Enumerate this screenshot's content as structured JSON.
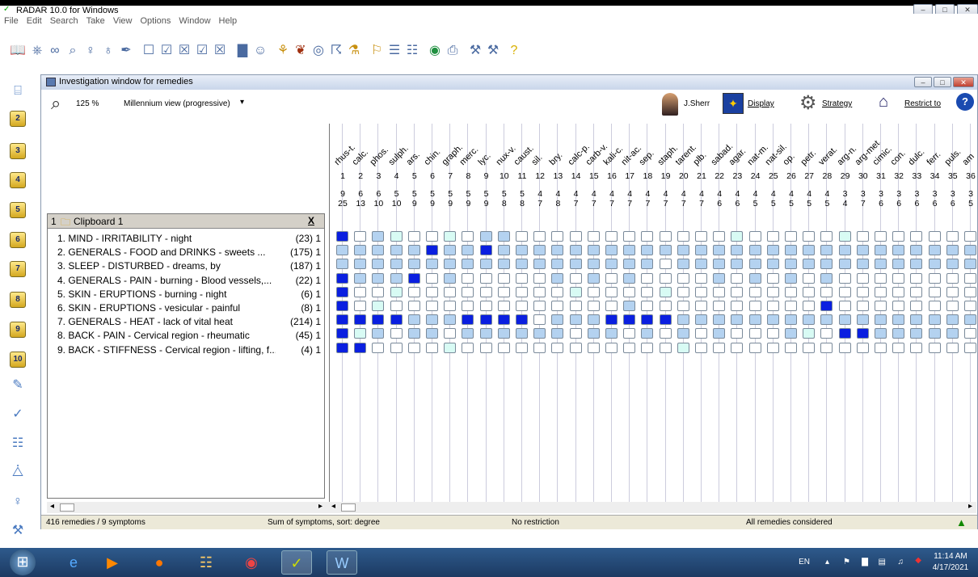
{
  "window": {
    "title": "RADAR 10.0 for Windows"
  },
  "menu": [
    "File",
    "Edit",
    "Search",
    "Take",
    "View",
    "Options",
    "Window",
    "Help"
  ],
  "rail_numbers": [
    "1",
    "2",
    "3",
    "4",
    "5",
    "6",
    "7",
    "8",
    "9",
    "10"
  ],
  "invwin": {
    "title": "Investigation window for remedies",
    "zoom": "125 %",
    "view": "Millennium view (progressive)",
    "author": "J.Sherr",
    "display": "Display",
    "strategy": "Strategy",
    "restrict": "Restrict to"
  },
  "clipboard": {
    "label": "1",
    "name": "Clipboard 1",
    "close": "X"
  },
  "symptoms": [
    {
      "text": "1. MIND - IRRITABILITY - night",
      "count": "(23) 1"
    },
    {
      "text": "2. GENERALS - FOOD and DRINKS - sweets ...",
      "count": "(175) 1"
    },
    {
      "text": "3. SLEEP - DISTURBED - dreams, by",
      "count": "(187) 1"
    },
    {
      "text": "4. GENERALS - PAIN - burning - Blood vessels,...",
      "count": "(22) 1"
    },
    {
      "text": "5. SKIN - ERUPTIONS - burning - night",
      "count": "(6) 1"
    },
    {
      "text": "6. SKIN - ERUPTIONS - vesicular - painful",
      "count": "(8) 1"
    },
    {
      "text": "7. GENERALS - HEAT - lack of vital heat",
      "count": "(214) 1"
    },
    {
      "text": "8. BACK - PAIN - Cervical region - rheumatic",
      "count": "(45) 1"
    },
    {
      "text": "9. BACK - STIFFNESS - Cervical region - lifting, f...",
      "count": "(4) 1"
    }
  ],
  "remedies": [
    "rhus-t.",
    "calc.",
    "phos.",
    "sulph.",
    "ars.",
    "chin.",
    "graph.",
    "merc.",
    "lyc.",
    "nux-v.",
    "caust.",
    "sil.",
    "bry.",
    "calc-p.",
    "carb-v.",
    "kali-c.",
    "nit-ac.",
    "sep.",
    "staph.",
    "tarent.",
    "plb.",
    "sabad.",
    "agar.",
    "nat-m.",
    "nat-sil.",
    "op.",
    "petr.",
    "verat.",
    "arg-n.",
    "arg-met.",
    "cimic.",
    "con.",
    "dulc.",
    "ferr.",
    "puls.",
    "am"
  ],
  "remedy_nums": [
    "1",
    "2",
    "3",
    "4",
    "5",
    "6",
    "7",
    "8",
    "9",
    "10",
    "11",
    "12",
    "13",
    "14",
    "15",
    "16",
    "17",
    "18",
    "19",
    "20",
    "21",
    "22",
    "23",
    "24",
    "25",
    "26",
    "27",
    "28",
    "29",
    "30",
    "31",
    "32",
    "33",
    "34",
    "35",
    "36"
  ],
  "scores": [
    "9",
    "6",
    "6",
    "5",
    "5",
    "5",
    "5",
    "5",
    "5",
    "5",
    "5",
    "4",
    "4",
    "4",
    "4",
    "4",
    "4",
    "4",
    "4",
    "4",
    "4",
    "4",
    "4",
    "4",
    "4",
    "4",
    "4",
    "4",
    "3",
    "3",
    "3",
    "3",
    "3",
    "3",
    "3",
    "3"
  ],
  "degrees": [
    "25",
    "13",
    "10",
    "10",
    "9",
    "9",
    "9",
    "9",
    "9",
    "8",
    "8",
    "7",
    "8",
    "7",
    "7",
    "7",
    "7",
    "7",
    "7",
    "7",
    "7",
    "6",
    "6",
    "5",
    "5",
    "5",
    "5",
    "5",
    "4",
    "7",
    "6",
    "6",
    "6",
    "6",
    "6",
    "5"
  ],
  "grid": [
    "3021001022000000000000100000100000000",
    "2222232232222222222222222222222222222",
    "2222222222222222220222222222222222222",
    "3222302000002020200002020202000000000",
    "3001000000000100001000000000000000000",
    "3010000000000000200000000003000000000",
    "3333222333302223333222222222222222222",
    "3120220222222022020202000210332222200",
    "3300001000000000000100000000000000000"
  ],
  "colors": {
    "d0": "#ffffff",
    "d1": "#d8fbf4",
    "d2": "#b4d2f0",
    "d3": "#0a1fe0"
  },
  "status": {
    "remedies": "416 remedies / 9 symptoms",
    "sort": "Sum of symptoms, sort: degree",
    "restrict": "No restriction",
    "considered": "All remedies considered"
  },
  "clock": {
    "time": "11:14 AM",
    "date": "4/17/2021",
    "lang": "EN"
  }
}
